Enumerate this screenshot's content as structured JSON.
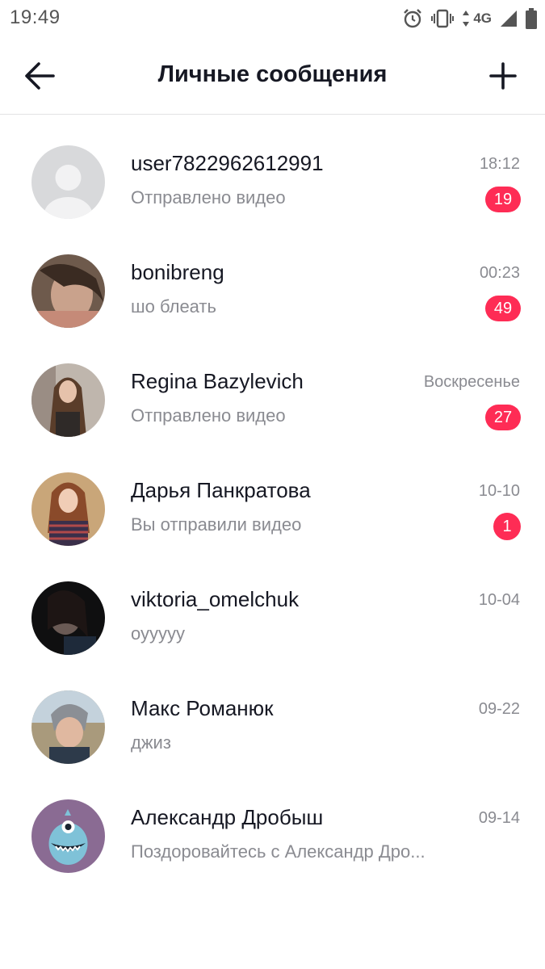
{
  "status_bar": {
    "time": "19:49",
    "network": "4G",
    "icons": [
      "alarm-icon",
      "vibrate-icon",
      "data-arrows-icon",
      "signal-icon",
      "battery-icon"
    ]
  },
  "header": {
    "title": "Личные сообщения",
    "back_icon": "arrow-left-icon",
    "add_icon": "plus-icon"
  },
  "colors": {
    "accent": "#fe2c55",
    "text_primary": "#161823",
    "text_secondary": "#8a8b91",
    "divider": "#e3e3e4"
  },
  "conversations": [
    {
      "name": "user7822962612991",
      "preview": "Отправлено видео",
      "time": "18:12",
      "unread": "19",
      "avatar": "default-avatar"
    },
    {
      "name": "bonibreng",
      "preview": "шо блеать",
      "time": "00:23",
      "unread": "49",
      "avatar": "photo-avatar"
    },
    {
      "name": "Regina Bazylevich",
      "preview": "Отправлено видео",
      "time": "Воскресенье",
      "unread": "27",
      "avatar": "photo-avatar"
    },
    {
      "name": "Дарья Панкратова",
      "preview": "Вы отправили видео",
      "time": "10-10",
      "unread": "1",
      "avatar": "photo-avatar"
    },
    {
      "name": "viktoria_omelchuk",
      "preview": "оууууу",
      "time": "10-04",
      "unread": "",
      "avatar": "photo-avatar"
    },
    {
      "name": "Макс Романюк",
      "preview": "джиз",
      "time": "09-22",
      "unread": "",
      "avatar": "photo-avatar"
    },
    {
      "name": "Александр Дробыш",
      "preview": "Поздоровайтесь с Александр Дро...",
      "time": "09-14",
      "unread": "",
      "avatar": "monster-avatar"
    }
  ]
}
